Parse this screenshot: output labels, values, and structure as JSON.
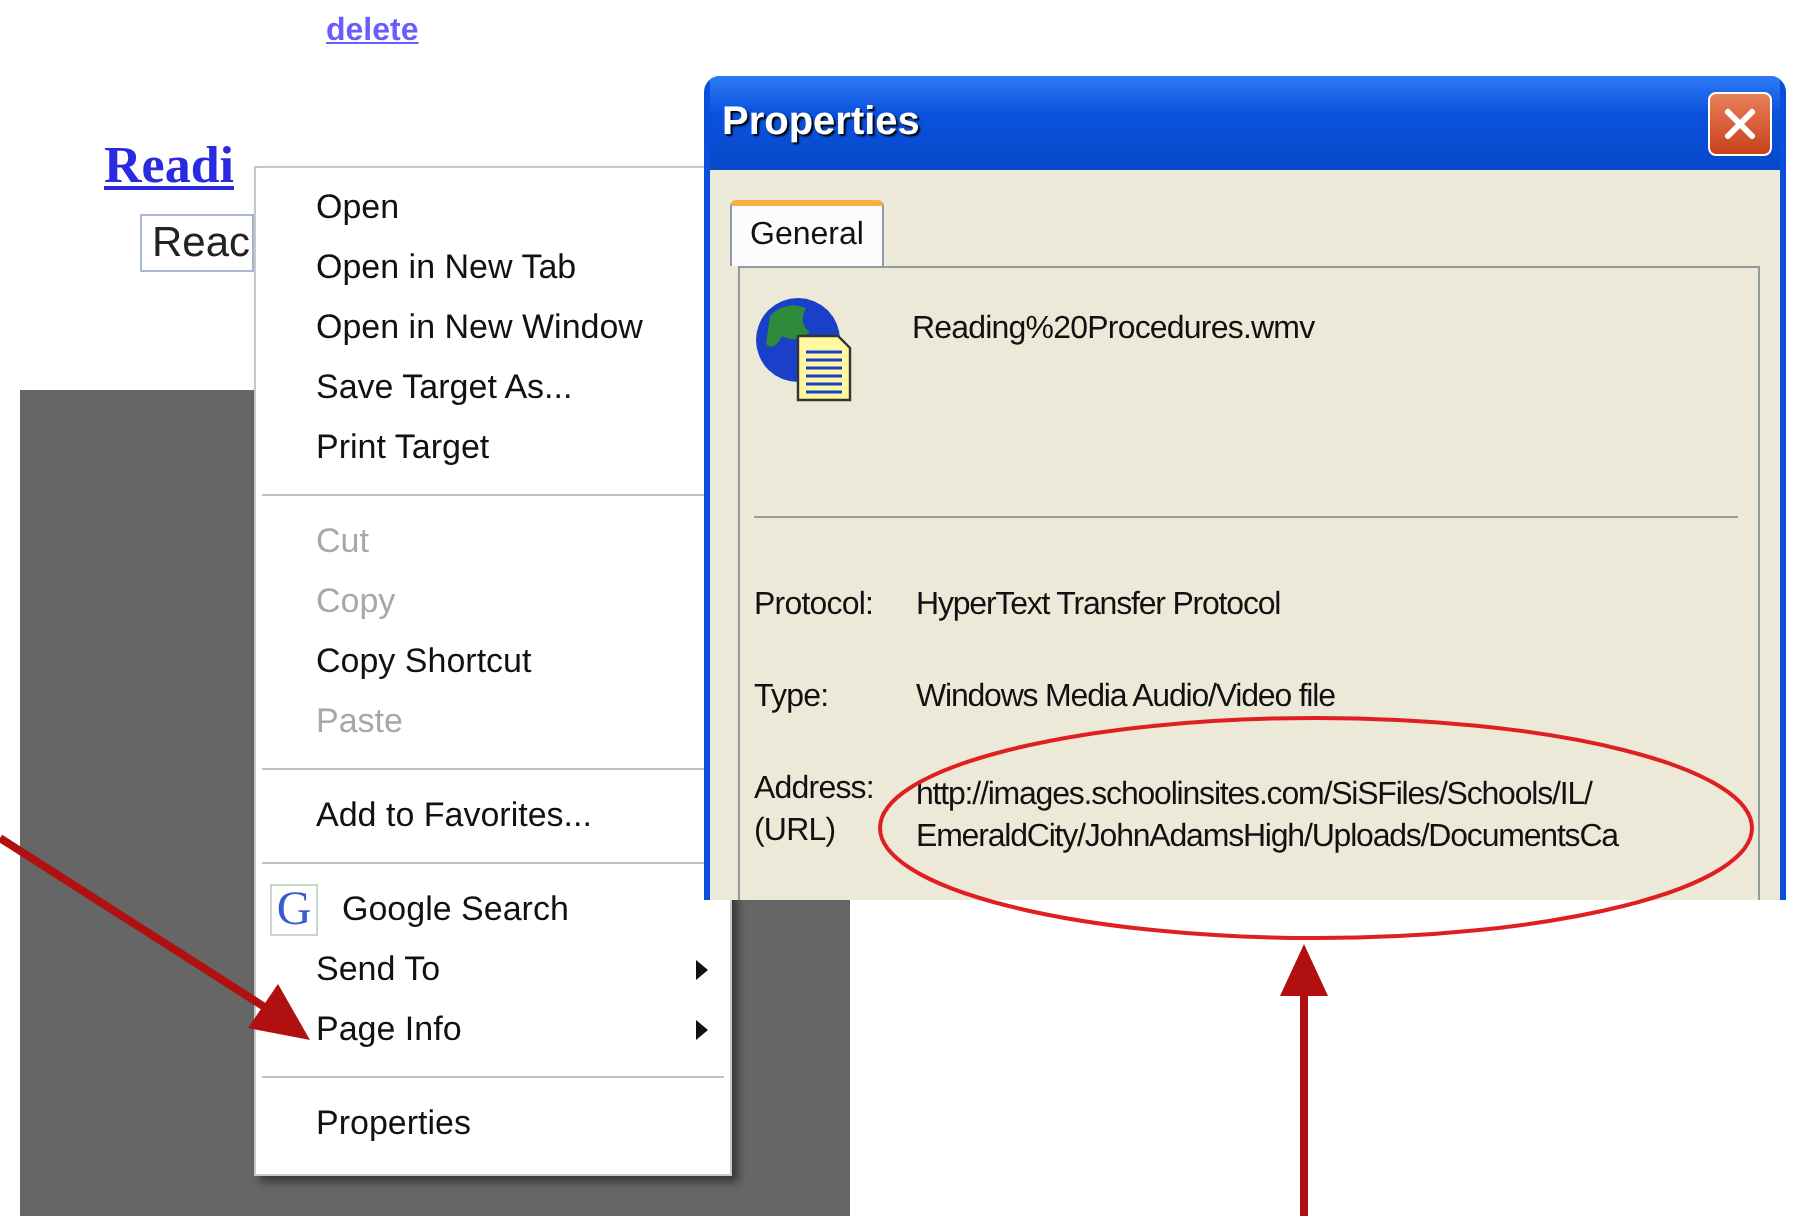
{
  "page": {
    "delete_link": "delete",
    "heading_link": "Readi",
    "input_value": "Reac"
  },
  "context_menu": {
    "items": [
      {
        "kind": "item",
        "label": "Open",
        "disabled": false,
        "submenu": false
      },
      {
        "kind": "item",
        "label": "Open in New Tab",
        "disabled": false,
        "submenu": false
      },
      {
        "kind": "item",
        "label": "Open in New Window",
        "disabled": false,
        "submenu": false
      },
      {
        "kind": "item",
        "label": "Save Target As...",
        "disabled": false,
        "submenu": false
      },
      {
        "kind": "item",
        "label": "Print Target",
        "disabled": false,
        "submenu": false
      },
      {
        "kind": "separator"
      },
      {
        "kind": "item",
        "label": "Cut",
        "disabled": true,
        "submenu": false
      },
      {
        "kind": "item",
        "label": "Copy",
        "disabled": true,
        "submenu": false
      },
      {
        "kind": "item",
        "label": "Copy Shortcut",
        "disabled": false,
        "submenu": false
      },
      {
        "kind": "item",
        "label": "Paste",
        "disabled": true,
        "submenu": false
      },
      {
        "kind": "separator"
      },
      {
        "kind": "item",
        "label": "Add to Favorites...",
        "disabled": false,
        "submenu": false
      },
      {
        "kind": "separator"
      },
      {
        "kind": "search",
        "label": "Google Search",
        "badge": "G",
        "disabled": false,
        "submenu": false
      },
      {
        "kind": "item",
        "label": "Send To",
        "disabled": false,
        "submenu": true
      },
      {
        "kind": "item",
        "label": "Page Info",
        "disabled": false,
        "submenu": true
      },
      {
        "kind": "separator"
      },
      {
        "kind": "item",
        "label": "Properties",
        "disabled": false,
        "submenu": false
      }
    ]
  },
  "dialog": {
    "title": "Properties",
    "tabs": [
      {
        "label": "General",
        "selected": true
      }
    ],
    "file_name": "Reading%20Procedures.wmv",
    "fields": [
      {
        "label": "Protocol:",
        "value": "HyperText Transfer Protocol"
      },
      {
        "label": "Type:",
        "value": "Windows Media Audio/Video file"
      },
      {
        "label": "Address:\n(URL)",
        "value": "http://images.schoolinsites.com/SiSFiles/Schools/IL/\nEmeraldCity/JohnAdamsHigh/Uploads/DocumentsCa"
      }
    ]
  }
}
